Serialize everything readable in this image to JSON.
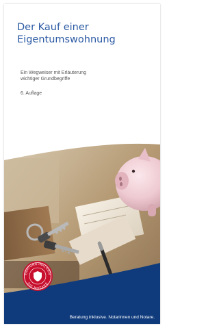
{
  "brochure": {
    "title_line1": "Der Kauf einer",
    "title_line2": "Eigentumswohnung",
    "subtitle_line1": "Ein Wegweiser mit Erläuterung",
    "subtitle_line2": "wichtiger Grundbegriffe",
    "edition": "6. Auflage",
    "footer_text": "Beratung inklusive. Notarinnen und Notare."
  },
  "seal": {
    "top_text": "BERATUNG INKLUSIVE",
    "bottom_text": "DIE NOTARE"
  },
  "photo": {
    "description_icons": [
      "piggy-bank-icon",
      "keys-icon",
      "pen-icon"
    ]
  },
  "colors": {
    "title": "#2b5aa3",
    "band": "#0f3b7c",
    "seal": "#c8102e"
  }
}
